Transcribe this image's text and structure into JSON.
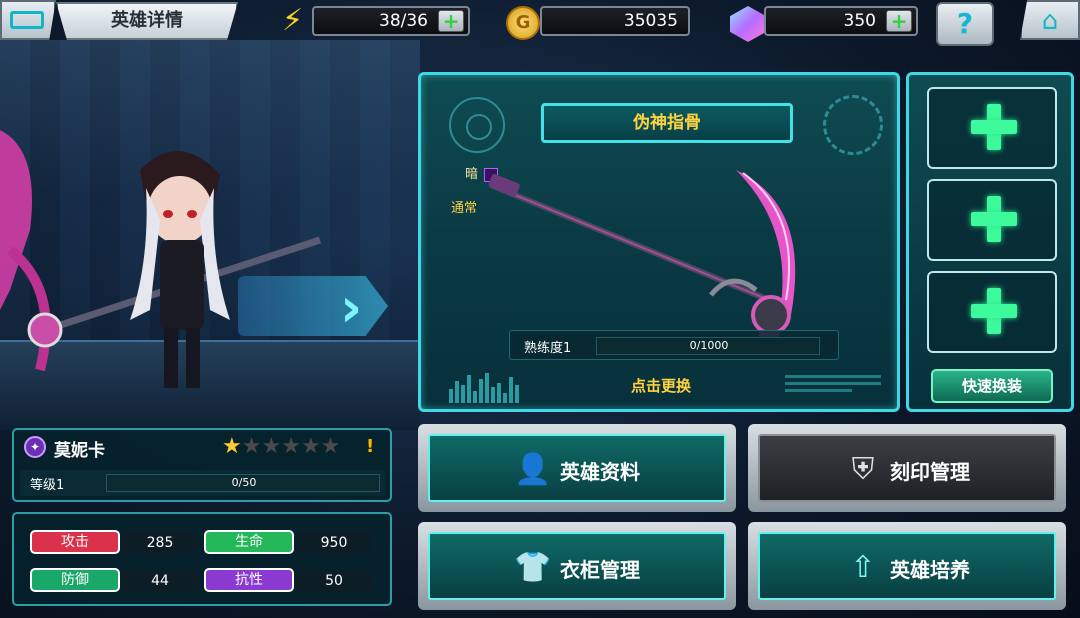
{
  "header": {
    "title": "英雄详情",
    "energy": "38/36",
    "gold": "35035",
    "gems": "350",
    "help_label": "?"
  },
  "weapon": {
    "name": "伪神指骨",
    "element": "暗",
    "type": "通常",
    "proficiency_label": "熟练度1",
    "proficiency_value": "0/1000",
    "change_label": "点击更换"
  },
  "slots": {
    "quick_equip_label": "快速换装"
  },
  "hero": {
    "name": "莫妮卡",
    "stars_filled": 1,
    "stars_total": 6,
    "warning": "!",
    "level_label": "等级1",
    "exp_value": "0/50",
    "exp_fraction": 0
  },
  "stats": {
    "attack_label": "攻击",
    "attack_value": "285",
    "hp_label": "生命",
    "hp_value": "950",
    "defense_label": "防御",
    "defense_value": "44",
    "resist_label": "抗性",
    "resist_value": "50"
  },
  "buttons": {
    "hero_info": "英雄资料",
    "imprint": "刻印管理",
    "wardrobe": "衣柜管理",
    "training": "英雄培养"
  },
  "colors": {
    "accent": "#3fd8e4",
    "title_gold": "#ffd23f",
    "attack": "#d9324a",
    "hp": "#25b85a",
    "defense": "#1aa86a",
    "resist": "#8a3ad0"
  }
}
